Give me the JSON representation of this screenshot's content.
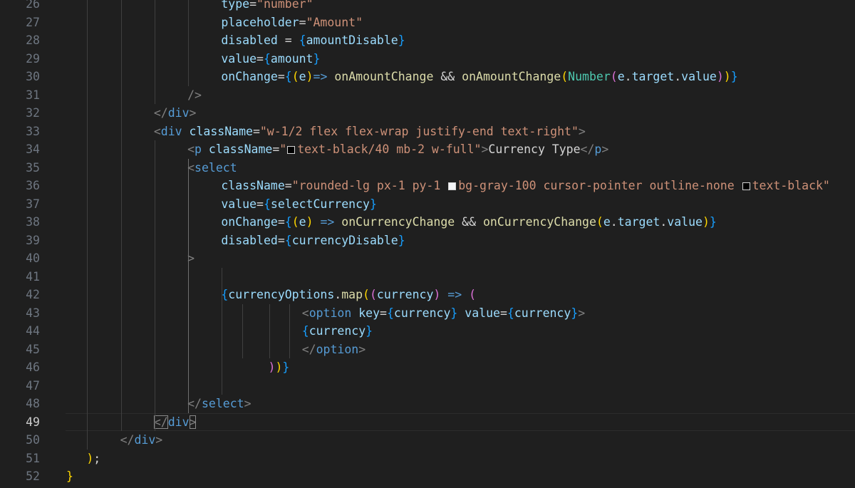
{
  "editor": {
    "current_line": 49,
    "lines": [
      {
        "n": 26,
        "indent": 23,
        "tokens": [
          [
            "attr",
            "type"
          ],
          [
            "op",
            "="
          ],
          [
            "str",
            "\"number\""
          ]
        ]
      },
      {
        "n": 27,
        "indent": 23,
        "tokens": [
          [
            "attr",
            "placeholder"
          ],
          [
            "op",
            "="
          ],
          [
            "str",
            "\"Amount\""
          ]
        ]
      },
      {
        "n": 28,
        "indent": 23,
        "tokens": [
          [
            "attr",
            "disabled"
          ],
          [
            "op",
            " = "
          ],
          [
            "b3",
            "{"
          ],
          [
            "var",
            "amountDisable"
          ],
          [
            "b3",
            "}"
          ]
        ]
      },
      {
        "n": 29,
        "indent": 23,
        "tokens": [
          [
            "attr",
            "value"
          ],
          [
            "op",
            "="
          ],
          [
            "b3",
            "{"
          ],
          [
            "var",
            "amount"
          ],
          [
            "b3",
            "}"
          ]
        ]
      },
      {
        "n": 30,
        "indent": 23,
        "tokens": [
          [
            "attr",
            "onChange"
          ],
          [
            "op",
            "="
          ],
          [
            "b3",
            "{"
          ],
          [
            "b1",
            "("
          ],
          [
            "var",
            "e"
          ],
          [
            "b1",
            ")"
          ],
          [
            "kw",
            "=>"
          ],
          [
            "op",
            " "
          ],
          [
            "fn",
            "onAmountChange"
          ],
          [
            "op",
            " && "
          ],
          [
            "fn",
            "onAmountChange"
          ],
          [
            "b1",
            "("
          ],
          [
            "type",
            "Number"
          ],
          [
            "b2",
            "("
          ],
          [
            "var",
            "e"
          ],
          [
            "op",
            "."
          ],
          [
            "var",
            "target"
          ],
          [
            "op",
            "."
          ],
          [
            "var",
            "value"
          ],
          [
            "b2",
            ")"
          ],
          [
            "b1",
            ")"
          ],
          [
            "b3",
            "}"
          ]
        ]
      },
      {
        "n": 31,
        "indent": 18,
        "tokens": [
          [
            "punc",
            "/>"
          ]
        ]
      },
      {
        "n": 32,
        "indent": 13,
        "tokens": [
          [
            "punc",
            "</"
          ],
          [
            "tag",
            "div"
          ],
          [
            "punc",
            ">"
          ]
        ]
      },
      {
        "n": 33,
        "indent": 13,
        "tokens": [
          [
            "punc",
            "<"
          ],
          [
            "tag",
            "div"
          ],
          [
            "op",
            " "
          ],
          [
            "attr",
            "className"
          ],
          [
            "op",
            "="
          ],
          [
            "str",
            "\"w-1/2 flex flex-wrap justify-end text-right\""
          ],
          [
            "punc",
            ">"
          ]
        ]
      },
      {
        "n": 34,
        "indent": 18,
        "tokens": [
          [
            "punc",
            "<"
          ],
          [
            "tag",
            "p"
          ],
          [
            "op",
            " "
          ],
          [
            "attr",
            "className"
          ],
          [
            "op",
            "="
          ],
          [
            "str",
            "\""
          ],
          [
            "swatch",
            "#000000"
          ],
          [
            "str",
            "text-black/40 mb-2 w-full\""
          ],
          [
            "punc",
            ">"
          ],
          [
            "text",
            "Currency Type"
          ],
          [
            "punc",
            "</"
          ],
          [
            "tag",
            "p"
          ],
          [
            "punc",
            ">"
          ]
        ]
      },
      {
        "n": 35,
        "indent": 18,
        "tokens": [
          [
            "punc",
            "<"
          ],
          [
            "tag",
            "select"
          ]
        ]
      },
      {
        "n": 36,
        "indent": 23,
        "tokens": [
          [
            "attr",
            "className"
          ],
          [
            "op",
            "="
          ],
          [
            "str",
            "\"rounded-lg px-1 py-1 "
          ],
          [
            "swatch",
            "#f3f4f6"
          ],
          [
            "str",
            "bg-gray-100 cursor-pointer outline-none "
          ],
          [
            "swatch",
            "#000000"
          ],
          [
            "str",
            "text-black\""
          ]
        ]
      },
      {
        "n": 37,
        "indent": 23,
        "tokens": [
          [
            "attr",
            "value"
          ],
          [
            "op",
            "="
          ],
          [
            "b3",
            "{"
          ],
          [
            "var",
            "selectCurrency"
          ],
          [
            "b3",
            "}"
          ]
        ]
      },
      {
        "n": 38,
        "indent": 23,
        "tokens": [
          [
            "attr",
            "onChange"
          ],
          [
            "op",
            "="
          ],
          [
            "b3",
            "{"
          ],
          [
            "b1",
            "("
          ],
          [
            "var",
            "e"
          ],
          [
            "b1",
            ")"
          ],
          [
            "op",
            " "
          ],
          [
            "kw",
            "=>"
          ],
          [
            "op",
            " "
          ],
          [
            "fn",
            "onCurrencyChange"
          ],
          [
            "op",
            " && "
          ],
          [
            "fn",
            "onCurrencyChange"
          ],
          [
            "b1",
            "("
          ],
          [
            "var",
            "e"
          ],
          [
            "op",
            "."
          ],
          [
            "var",
            "target"
          ],
          [
            "op",
            "."
          ],
          [
            "var",
            "value"
          ],
          [
            "b1",
            ")"
          ],
          [
            "b3",
            "}"
          ]
        ]
      },
      {
        "n": 39,
        "indent": 23,
        "tokens": [
          [
            "attr",
            "disabled"
          ],
          [
            "op",
            "="
          ],
          [
            "b3",
            "{"
          ],
          [
            "var",
            "currencyDisable"
          ],
          [
            "b3",
            "}"
          ]
        ]
      },
      {
        "n": 40,
        "indent": 18,
        "tokens": [
          [
            "punc",
            ">"
          ]
        ]
      },
      {
        "n": 41,
        "indent": 0,
        "tokens": []
      },
      {
        "n": 42,
        "indent": 23,
        "tokens": [
          [
            "b3",
            "{"
          ],
          [
            "var",
            "currencyOptions"
          ],
          [
            "op",
            "."
          ],
          [
            "fn",
            "map"
          ],
          [
            "b1",
            "("
          ],
          [
            "b2",
            "("
          ],
          [
            "var",
            "currency"
          ],
          [
            "b2",
            ")"
          ],
          [
            "op",
            " "
          ],
          [
            "kw",
            "=>"
          ],
          [
            "op",
            " "
          ],
          [
            "b2",
            "("
          ]
        ]
      },
      {
        "n": 43,
        "indent": 35,
        "tokens": [
          [
            "punc",
            "<"
          ],
          [
            "tag",
            "option"
          ],
          [
            "op",
            " "
          ],
          [
            "attr",
            "key"
          ],
          [
            "op",
            "="
          ],
          [
            "b3",
            "{"
          ],
          [
            "var",
            "currency"
          ],
          [
            "b3",
            "}"
          ],
          [
            "op",
            " "
          ],
          [
            "attr",
            "value"
          ],
          [
            "op",
            "="
          ],
          [
            "b3",
            "{"
          ],
          [
            "var",
            "currency"
          ],
          [
            "b3",
            "}"
          ],
          [
            "punc",
            ">"
          ]
        ]
      },
      {
        "n": 44,
        "indent": 35,
        "tokens": [
          [
            "b3",
            "{"
          ],
          [
            "var",
            "currency"
          ],
          [
            "b3",
            "}"
          ]
        ]
      },
      {
        "n": 45,
        "indent": 35,
        "tokens": [
          [
            "punc",
            "</"
          ],
          [
            "tag",
            "option"
          ],
          [
            "punc",
            ">"
          ]
        ]
      },
      {
        "n": 46,
        "indent": 30,
        "tokens": [
          [
            "b2",
            ")"
          ],
          [
            "b1",
            ")"
          ],
          [
            "b3",
            "}"
          ]
        ]
      },
      {
        "n": 47,
        "indent": 0,
        "tokens": []
      },
      {
        "n": 48,
        "indent": 18,
        "tokens": [
          [
            "punc",
            "</"
          ],
          [
            "tag",
            "select"
          ],
          [
            "punc",
            ">"
          ]
        ]
      },
      {
        "n": 49,
        "indent": 13,
        "tokens": [
          [
            "punc",
            "</"
          ],
          [
            "tag",
            "div"
          ],
          [
            "punc",
            ">"
          ]
        ],
        "bracket_match": true
      },
      {
        "n": 50,
        "indent": 8,
        "tokens": [
          [
            "punc",
            "</"
          ],
          [
            "tag",
            "div"
          ],
          [
            "punc",
            ">"
          ]
        ]
      },
      {
        "n": 51,
        "indent": 3,
        "tokens": [
          [
            "b1",
            ")"
          ],
          [
            "op",
            ";"
          ]
        ]
      },
      {
        "n": 52,
        "indent": 0,
        "tokens": [
          [
            "b1",
            "}"
          ]
        ]
      }
    ]
  }
}
